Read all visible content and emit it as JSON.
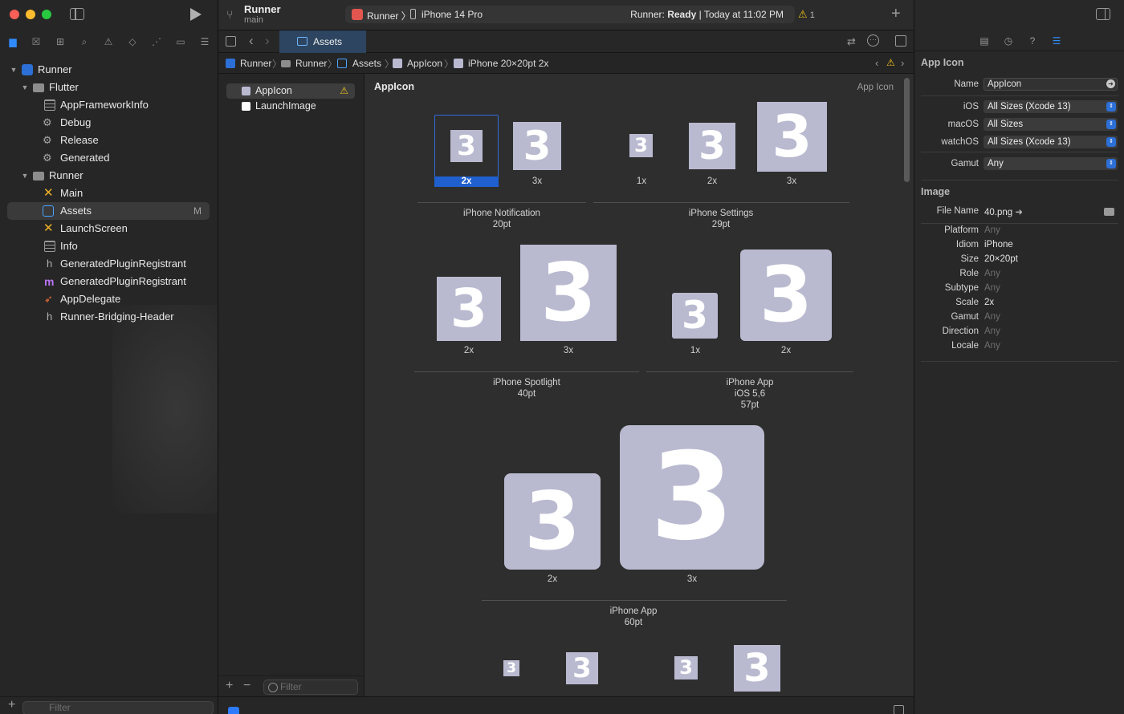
{
  "window": {
    "scheme_project": "Runner",
    "branch": "main"
  },
  "toolbar": {
    "scheme_app": "Runner",
    "device": "iPhone 14 Pro",
    "status_prefix": "Runner:",
    "status_state": "Ready",
    "status_time": "| Today at 11:02 PM",
    "warning_count": "1"
  },
  "navigator": {
    "items": [
      {
        "label": "Runner",
        "icon": "project-icon"
      },
      {
        "label": "Flutter",
        "icon": "folder-icon"
      },
      {
        "label": "AppFrameworkInfo",
        "icon": "plist-icon"
      },
      {
        "label": "Debug",
        "icon": "config-gear-icon"
      },
      {
        "label": "Release",
        "icon": "config-gear-icon"
      },
      {
        "label": "Generated",
        "icon": "config-gear-icon"
      },
      {
        "label": "Runner",
        "icon": "folder-icon"
      },
      {
        "label": "Main",
        "icon": "storyboard-icon"
      },
      {
        "label": "Assets",
        "icon": "asset-catalog-icon",
        "badge": "M"
      },
      {
        "label": "LaunchScreen",
        "icon": "storyboard-icon"
      },
      {
        "label": "Info",
        "icon": "plist-icon"
      },
      {
        "label": "GeneratedPluginRegistrant",
        "icon": "header-file-icon"
      },
      {
        "label": "GeneratedPluginRegistrant",
        "icon": "objc-file-icon"
      },
      {
        "label": "AppDelegate",
        "icon": "swift-file-icon"
      },
      {
        "label": "Runner-Bridging-Header",
        "icon": "header-file-icon"
      }
    ],
    "filter_placeholder": "Filter"
  },
  "editor_tab": {
    "label": "Assets"
  },
  "jumpbar": [
    "Runner",
    "Runner",
    "Assets",
    "AppIcon",
    "iPhone 20×20pt 2x"
  ],
  "asset_list": {
    "items": [
      {
        "label": "AppIcon",
        "selected": true,
        "warning": true
      },
      {
        "label": "LaunchImage",
        "selected": false,
        "warning": false
      }
    ],
    "filter_placeholder": "Filter"
  },
  "canvas": {
    "title": "AppIcon",
    "asset_type": "App Icon",
    "icon_glyph": "3",
    "groups": [
      {
        "name": "iPhone Notification",
        "detail": "20pt",
        "scales": [
          "2x",
          "3x"
        ]
      },
      {
        "name": "iPhone Settings",
        "detail": "29pt",
        "scales": [
          "1x",
          "2x",
          "3x"
        ]
      },
      {
        "name": "iPhone Spotlight",
        "detail": "40pt",
        "scales": [
          "2x",
          "3x"
        ]
      },
      {
        "name": "iPhone App",
        "detail": "iOS 5,6",
        "detail2": "57pt",
        "scales": [
          "1x",
          "2x"
        ]
      },
      {
        "name": "iPhone App",
        "detail": "60pt",
        "scales": [
          "2x",
          "3x"
        ]
      }
    ],
    "selected_scale": "2x"
  },
  "inspector": {
    "section_appicon": "App Icon",
    "name_label": "Name",
    "name_value": "AppIcon",
    "ios_label": "iOS",
    "ios_value": "All Sizes (Xcode 13)",
    "macos_label": "macOS",
    "macos_value": "All Sizes",
    "watchos_label": "watchOS",
    "watchos_value": "All Sizes (Xcode 13)",
    "gamut_label": "Gamut",
    "gamut_value": "Any",
    "section_image": "Image",
    "filename_label": "File Name",
    "filename_value": "40.png",
    "props": [
      {
        "label": "Platform",
        "value": "Any",
        "dim": true
      },
      {
        "label": "Idiom",
        "value": "iPhone",
        "dim": false
      },
      {
        "label": "Size",
        "value": "20×20pt",
        "dim": false
      },
      {
        "label": "Role",
        "value": "Any",
        "dim": true
      },
      {
        "label": "Subtype",
        "value": "Any",
        "dim": true
      },
      {
        "label": "Scale",
        "value": "2x",
        "dim": false
      },
      {
        "label": "Gamut",
        "value": "Any",
        "dim": true
      },
      {
        "label": "Direction",
        "value": "Any",
        "dim": true
      },
      {
        "label": "Locale",
        "value": "Any",
        "dim": true
      }
    ]
  },
  "colors": {
    "accent": "#2f6cd6",
    "icon_fill": "#b9bad0",
    "warning": "#f2c31a"
  }
}
